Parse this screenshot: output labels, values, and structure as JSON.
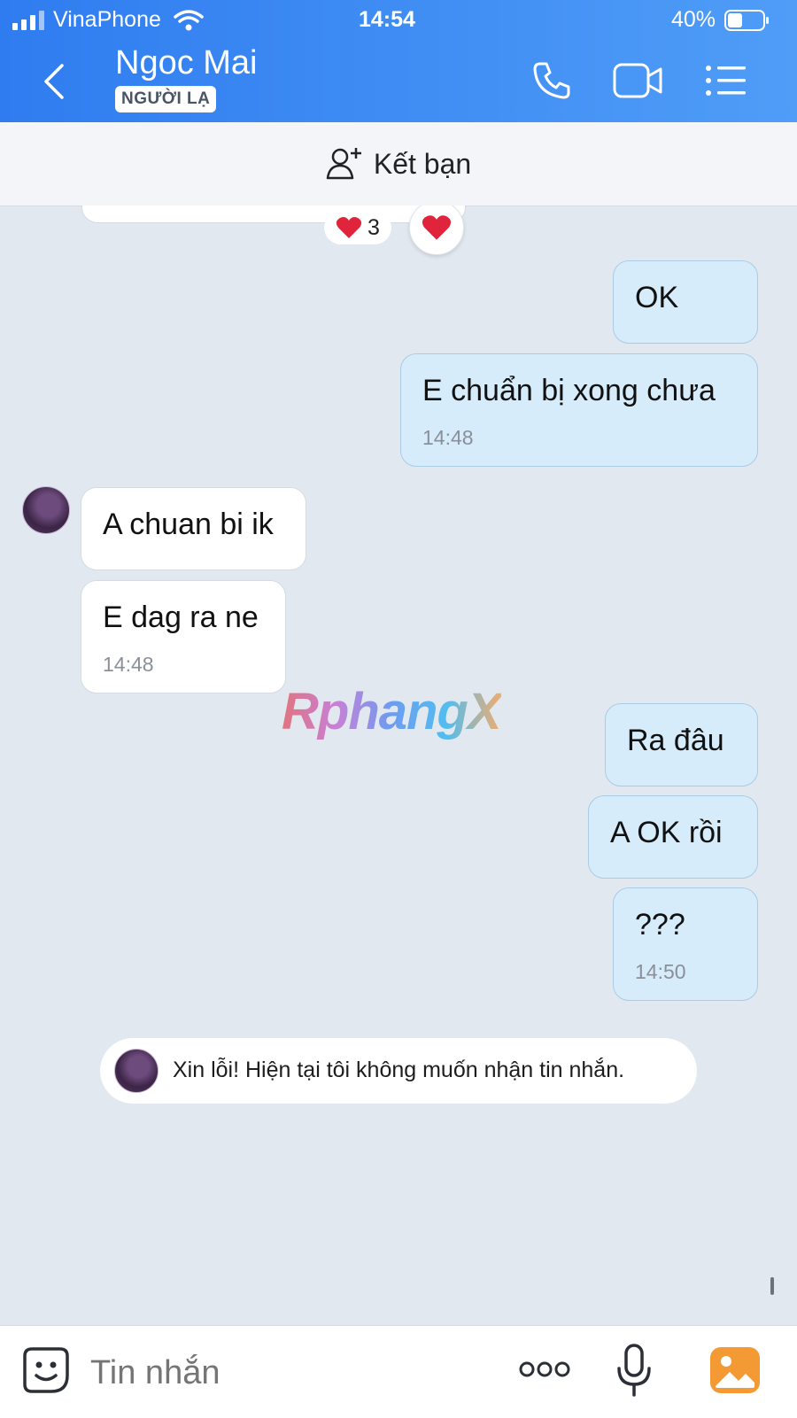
{
  "status_bar": {
    "carrier": "VinaPhone",
    "time": "14:54",
    "battery": "40%"
  },
  "header": {
    "contact_name": "Ngoc Mai",
    "stranger_badge": "NGƯỜI LẠ"
  },
  "friend_bar": {
    "label": "Kết bạn"
  },
  "reaction": {
    "count": "3"
  },
  "messages": [
    {
      "direction": "out",
      "text": "OK",
      "time": ""
    },
    {
      "direction": "out",
      "text": "E chuẩn bị xong chưa",
      "time": "14:48"
    },
    {
      "direction": "in",
      "text": "A chuan bi ik",
      "time": ""
    },
    {
      "direction": "in",
      "text": "E dag ra ne",
      "time": "14:48"
    },
    {
      "direction": "out",
      "text": "Ra đâu",
      "time": ""
    },
    {
      "direction": "out",
      "text": "A OK rồi",
      "time": ""
    },
    {
      "direction": "out",
      "text": "???",
      "time": "14:50"
    }
  ],
  "auto_reply": {
    "text": "Xin lỗi! Hiện tại tôi không muốn nhận tin nhắn."
  },
  "watermark": {
    "text": "RphangX"
  },
  "composer": {
    "placeholder": "Tin nhắn"
  },
  "icons": [
    "back-icon",
    "phone-icon",
    "video-icon",
    "menu-icon",
    "add-friend-icon",
    "heart-icon",
    "sticker-icon",
    "more-icon",
    "microphone-icon",
    "gallery-icon"
  ],
  "colors": {
    "header": "#2f7cf0",
    "outgoing_bubble": "#d6ecfb",
    "incoming_bubble": "#ffffff",
    "background": "#e2e8f0"
  }
}
